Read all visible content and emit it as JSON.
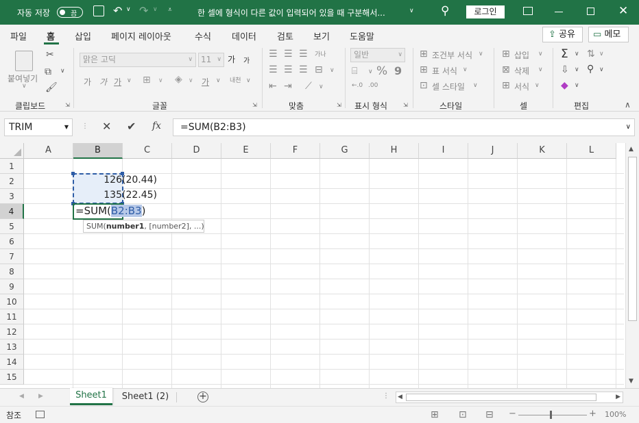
{
  "titlebar": {
    "autosave_label": "자동 저장",
    "autosave_state": "끔",
    "doc_title": "한 셀에 형식이 다른 값이 입력되어 있을 때 구분해서...",
    "login_label": "로그인",
    "bg_color": "#217346"
  },
  "menu": {
    "tabs": [
      "파일",
      "홈",
      "삽입",
      "페이지 레이아웃",
      "수식",
      "데이터",
      "검토",
      "보기",
      "도움말"
    ],
    "active_tab": "홈",
    "share_label": "공유",
    "memo_label": "메모"
  },
  "ribbon": {
    "clipboard": {
      "paste": "붙여넣기",
      "group": "클립보드"
    },
    "font": {
      "name": "맑은 고딕",
      "size": "11",
      "grow": "가",
      "shrink": "가",
      "bold": "가",
      "italic": "가",
      "underline": "가",
      "strike": "가",
      "phonetic": "내천",
      "group": "글꼴"
    },
    "align": {
      "wrap": "가나",
      "group": "맞춤"
    },
    "number": {
      "format": "일반",
      "percent": "%",
      "comma": "9",
      "group": "표시 형식"
    },
    "styles": {
      "conditional": "조건부 서식",
      "table": "표 서식",
      "cell_style": "셀 스타일",
      "group": "스타일"
    },
    "cells": {
      "insert": "삽입",
      "delete": "삭제",
      "format": "서식",
      "group": "셀"
    },
    "edit": {
      "sum": "Σ",
      "group": "편집"
    }
  },
  "formula_bar": {
    "name_box": "TRIM",
    "fx": "fx",
    "formula": "=SUM(B2:B3)"
  },
  "columns": [
    "A",
    "B",
    "C",
    "D",
    "E",
    "F",
    "G",
    "H",
    "I",
    "J",
    "K",
    "L"
  ],
  "rows": [
    "1",
    "2",
    "3",
    "4",
    "5",
    "6",
    "7",
    "8",
    "9",
    "10",
    "11",
    "12",
    "13",
    "14",
    "15"
  ],
  "cells": {
    "B2": "126",
    "C2": "(20.44)",
    "B3": "135",
    "C3": "(22.45)",
    "B4_prefix": "=SUM(",
    "B4_ref": "B2:B3",
    "B4_suffix": ")"
  },
  "tooltip": {
    "fn": "SUM(",
    "arg1": "number1",
    "rest": ", [number2], ...)"
  },
  "sheets": [
    "Sheet1",
    "Sheet1 (2)"
  ],
  "active_sheet": "Sheet1",
  "status": {
    "mode": "참조",
    "zoom": "100%"
  }
}
